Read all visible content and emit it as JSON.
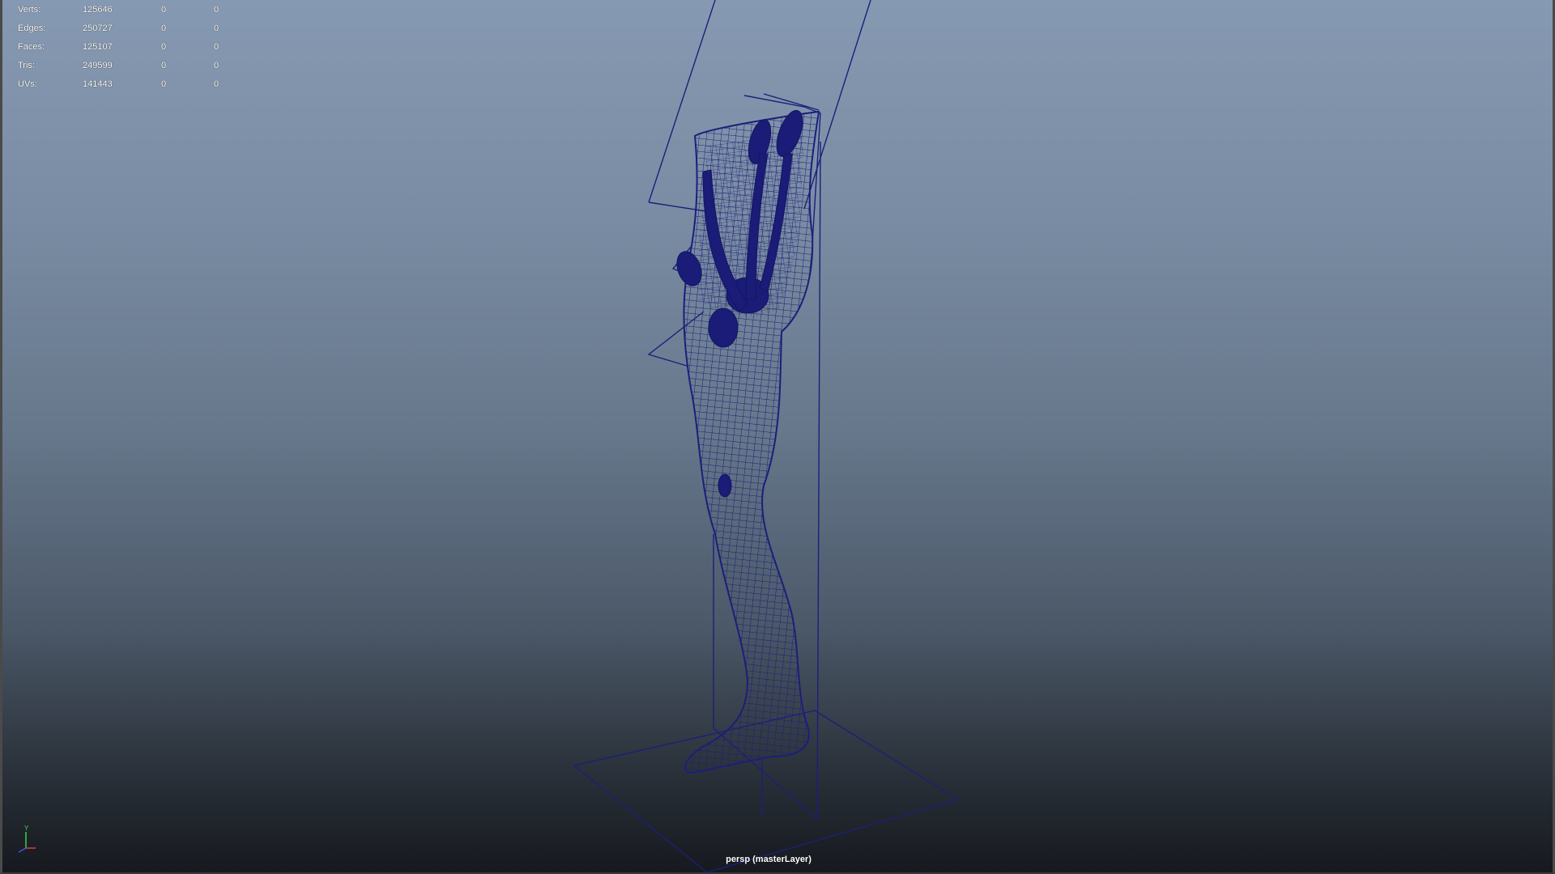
{
  "viewport": {
    "camera_label": "persp (masterLayer)",
    "background_top": "#8699b2",
    "background_bottom": "#16191e",
    "wireframe_color": "#1c1f7a"
  },
  "hud": {
    "rows": [
      {
        "label": "Verts:",
        "total": "125646",
        "selected": "0",
        "component": "0"
      },
      {
        "label": "Edges:",
        "total": "250727",
        "selected": "0",
        "component": "0"
      },
      {
        "label": "Faces:",
        "total": "125107",
        "selected": "0",
        "component": "0"
      },
      {
        "label": "Tris:",
        "total": "249599",
        "selected": "0",
        "component": "0"
      },
      {
        "label": "UVs:",
        "total": "141443",
        "selected": "0",
        "component": "0"
      }
    ]
  },
  "axis_gizmo": {
    "y_label": "Y",
    "y_color": "#3fd03f",
    "x_color": "#e03a3a",
    "z_color": "#3a5ae0",
    "icon": "axis-orientation-icon"
  }
}
